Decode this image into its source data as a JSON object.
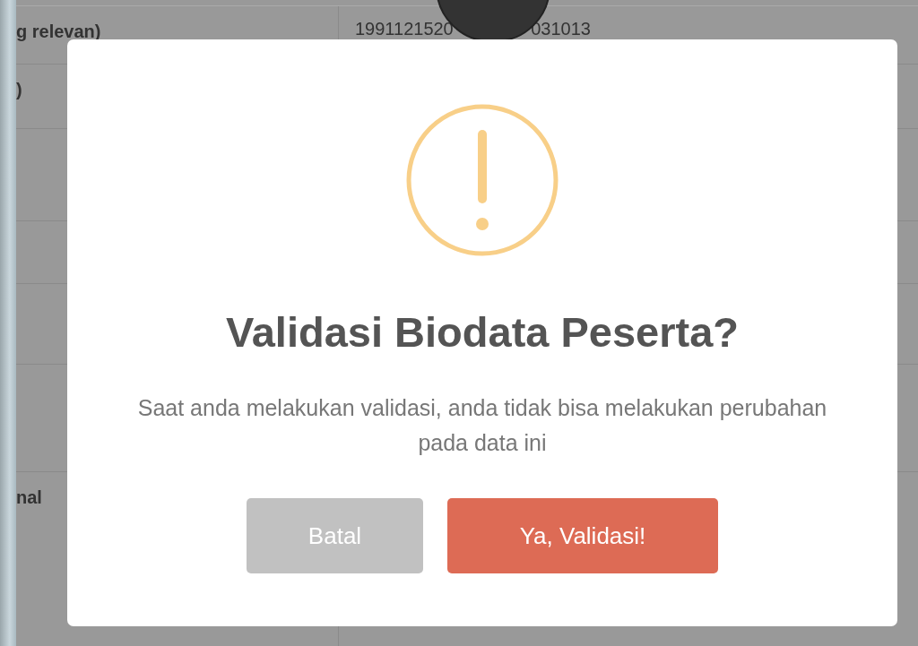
{
  "background_table": {
    "rows": [
      {
        "label": "g relevan)",
        "value_parts": [
          "1991121520",
          "031013"
        ]
      },
      {
        "label": ")"
      },
      {
        "label": "nal"
      }
    ]
  },
  "dialog": {
    "title": "Validasi Biodata Peserta?",
    "message": "Saat anda melakukan validasi, anda tidak bisa melakukan perubahan pada data ini",
    "buttons": [
      {
        "label": "Batal",
        "kind": "cancel"
      },
      {
        "label": "Ya, Validasi!",
        "kind": "confirm"
      }
    ]
  }
}
